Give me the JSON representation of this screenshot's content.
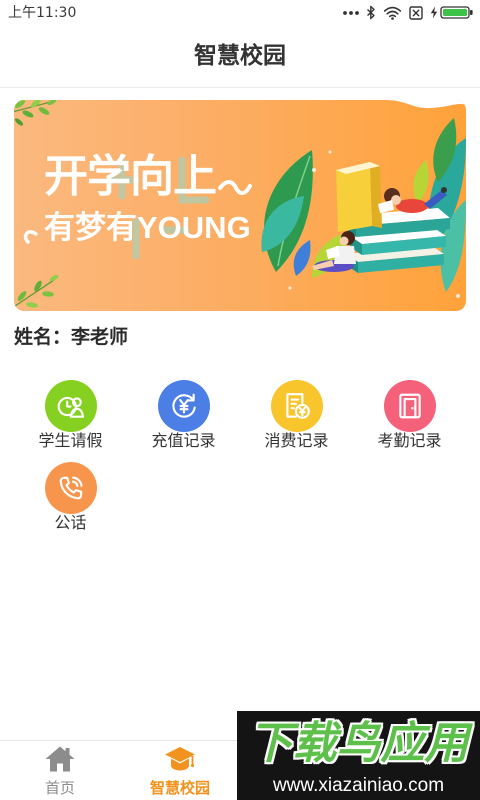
{
  "status_bar": {
    "time": "上午11:30",
    "icons": [
      "more-dots-icon",
      "bluetooth-icon",
      "wifi-icon",
      "sim-card-off-icon",
      "charging-icon",
      "battery-icon"
    ],
    "battery_level": 1,
    "battery_color": "#3ec34a"
  },
  "header": {
    "title": "智慧校园"
  },
  "banner": {
    "line1": "开学向上",
    "line2": "有梦有YOUNG"
  },
  "user": {
    "name_label": "姓名：",
    "name": "李老师"
  },
  "features": [
    {
      "label": "学生请假",
      "icon": "leave-icon",
      "color": "#86d021"
    },
    {
      "label": "充值记录",
      "icon": "recharge-icon",
      "color": "#4b7fe6"
    },
    {
      "label": "消费记录",
      "icon": "consumption-icon",
      "color": "#f8c52c"
    },
    {
      "label": "考勤记录",
      "icon": "attendance-icon",
      "color": "#f5617a"
    },
    {
      "label": "公话",
      "icon": "phone-icon",
      "color": "#f7954c"
    }
  ],
  "tab_bar": {
    "tabs": [
      {
        "label": "首页",
        "icon": "home-icon",
        "active": false,
        "color": "#8c8c8c"
      },
      {
        "label": "智慧校园",
        "icon": "graduation-cap-icon",
        "active": true,
        "color": "#f29320"
      }
    ]
  },
  "watermark": {
    "title": "下载鸟应用",
    "url": "www.xiazainiao.com"
  }
}
